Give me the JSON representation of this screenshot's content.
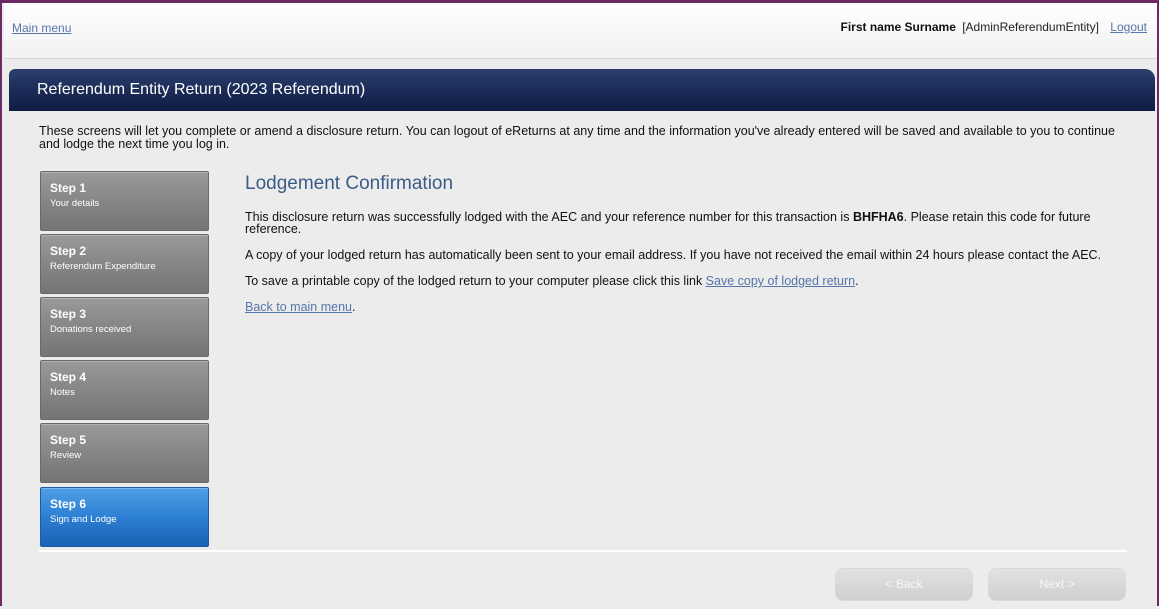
{
  "topbar": {
    "main_menu": "Main menu",
    "user_name": "First name Surname",
    "user_role": "[AdminReferendumEntity]",
    "logout": "Logout"
  },
  "panel": {
    "title": "Referendum Entity Return (2023 Referendum)",
    "intro": "These screens will let you complete or amend a disclosure return. You can logout of eReturns at any time and the information you've already entered will be saved and available to you to continue and lodge the next time you log in."
  },
  "steps": [
    {
      "title": "Step 1",
      "subtitle": "Your details",
      "active": false
    },
    {
      "title": "Step 2",
      "subtitle": "Referendum Expenditure",
      "active": false
    },
    {
      "title": "Step 3",
      "subtitle": "Donations received",
      "active": false
    },
    {
      "title": "Step 4",
      "subtitle": "Notes",
      "active": false
    },
    {
      "title": "Step 5",
      "subtitle": "Review",
      "active": false
    },
    {
      "title": "Step 6",
      "subtitle": "Sign and Lodge",
      "active": true
    }
  ],
  "confirmation": {
    "title": "Lodgement Confirmation",
    "para1_before": "This disclosure return was successfully lodged with the AEC and your reference number for this transaction is ",
    "reference": "BHFHA6",
    "para1_after": ". Please retain this code for future reference.",
    "para2": "A copy of your lodged return has automatically been sent to your email address. If you have not received the email within 24 hours please contact the AEC.",
    "para3_before": "To save a printable copy of the lodged return to your computer please click this link ",
    "save_link": "Save copy of lodged return",
    "para3_after": ".",
    "back_link": "Back to main menu",
    "back_after": "."
  },
  "footer": {
    "back": "< Back",
    "next": "Next >"
  },
  "colors": {
    "header_bg": "#1a2a55",
    "step_inactive": "#8a8a8a",
    "step_active": "#2c7fd3",
    "link": "#5577aa",
    "title": "#3a5c86",
    "frame": "#6b2a63"
  }
}
